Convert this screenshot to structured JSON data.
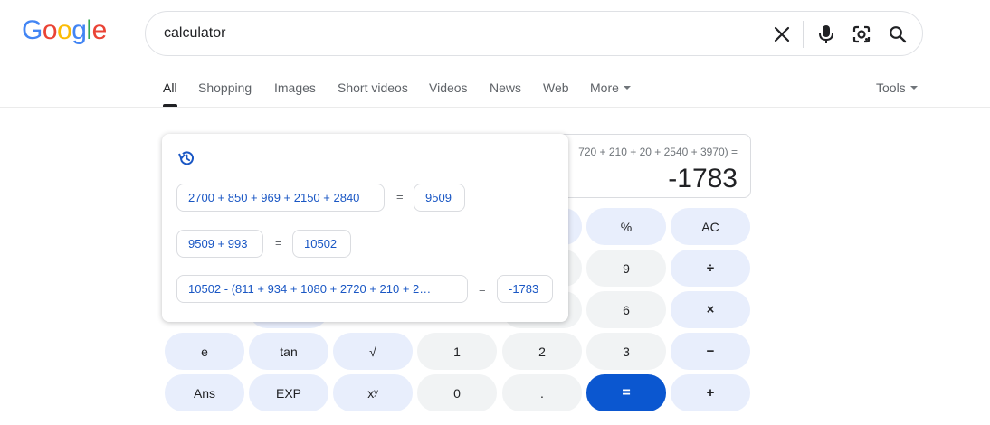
{
  "logo": {
    "letters": [
      "G",
      "o",
      "o",
      "g",
      "l",
      "e"
    ],
    "colors": [
      "#4285f4",
      "#ea4335",
      "#fbbc05",
      "#4285f4",
      "#34a853",
      "#ea4335"
    ]
  },
  "search": {
    "query": "calculator",
    "icons": [
      "close-icon",
      "microphone-icon",
      "lens-icon",
      "search-icon"
    ]
  },
  "tabs": {
    "items": [
      "All",
      "Shopping",
      "Images",
      "Short videos",
      "Videos",
      "News",
      "Web",
      "More"
    ],
    "tools": "Tools"
  },
  "calculator": {
    "expression": "720 + 210 + 20 + 2540 + 3970) =",
    "result": "-1783",
    "buttons": {
      "percent": "%",
      "ac": "AC",
      "nine": "9",
      "divide": "÷",
      "six": "6",
      "multiply": "×",
      "e": "e",
      "tan": "tan",
      "sqrt": "√",
      "one": "1",
      "two": "2",
      "three": "3",
      "minus": "−",
      "ans": "Ans",
      "exp": "EXP",
      "power": "xʸ",
      "zero": "0",
      "dot": ".",
      "equals": "=",
      "plus": "+"
    }
  },
  "history": {
    "icon": "history-icon",
    "entries": [
      {
        "expression": "2700 + 850 + 969 + 2150 + 2840",
        "equals": "=",
        "result": "9509"
      },
      {
        "expression": "9509 + 993",
        "equals": "=",
        "result": "10502"
      },
      {
        "expression": "10502 - (811 + 934 + 1080 + 2720 + 210 + 2…",
        "equals": "=",
        "result": "-1783"
      }
    ]
  },
  "colors": {
    "accent": "#0b57d0",
    "link": "#1a57c4",
    "button_light": "#f1f3f4",
    "button_fn": "#e8eefc"
  }
}
